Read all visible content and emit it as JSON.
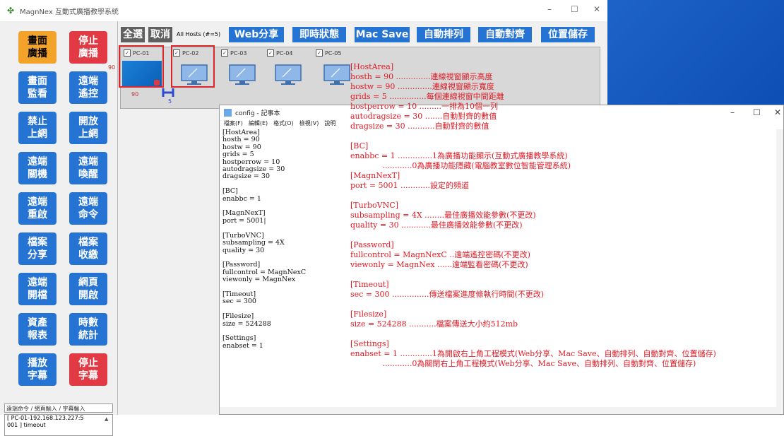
{
  "window": {
    "title": "MagnNex 互動式廣播教學系統",
    "min": "–",
    "max": "☐",
    "close": "✕"
  },
  "sidebar": {
    "buttons": [
      {
        "label": "畫面\n廣播",
        "style": "orange"
      },
      {
        "label": "停止\n廣播",
        "style": "red"
      },
      {
        "label": "畫面\n監看",
        "style": "blue"
      },
      {
        "label": "遠端\n遙控",
        "style": "blue"
      },
      {
        "label": "禁止\n上網",
        "style": "blue"
      },
      {
        "label": "開放\n上網",
        "style": "blue"
      },
      {
        "label": "遠端\n關機",
        "style": "blue"
      },
      {
        "label": "遠端\n喚醒",
        "style": "blue"
      },
      {
        "label": "遠端\n重啟",
        "style": "blue"
      },
      {
        "label": "遠端\n命令",
        "style": "blue"
      },
      {
        "label": "檔案\n分享",
        "style": "blue"
      },
      {
        "label": "檔案\n收繳",
        "style": "blue"
      },
      {
        "label": "遠端\n開檔",
        "style": "blue"
      },
      {
        "label": "網頁\n開啟",
        "style": "blue"
      },
      {
        "label": "資產\n報表",
        "style": "blue"
      },
      {
        "label": "時數\n統計",
        "style": "blue"
      },
      {
        "label": "播放\n字幕",
        "style": "blue"
      },
      {
        "label": "停止\n字幕",
        "style": "red"
      }
    ],
    "command_label": "遠端命令 / 網頁輸入 / 字幕輸入",
    "log": [
      "[ PC-01-192.168.123.227:5",
      "001 ] timeout"
    ]
  },
  "toolbar": {
    "select_all": "全選",
    "cancel": "取消",
    "all_hosts": "All Hosts (#=5)",
    "web_share": "Web分享",
    "instant_status": "即時狀態",
    "mac_save": "Mac Save",
    "auto_arrange": "自動排列",
    "auto_align": "自動對齊",
    "save_position": "位置儲存"
  },
  "hosts": [
    "PC-01",
    "PC-02",
    "PC-03",
    "PC-04",
    "PC-05"
  ],
  "dims": {
    "height": "90",
    "width": "90",
    "grid": "5"
  },
  "notepad": {
    "title": "config - 記事本",
    "menu": [
      "檔案(F)",
      "編輯(E)",
      "格式(O)",
      "檢視(V)",
      "說明"
    ],
    "content": "[HostArea]\nhosth = 90\nhostw = 90\ngrids = 5\nhostperrow = 10\nautodragsize = 30\ndragsize = 30\n\n[BC]\nenabbc = 1\n\n[MagnNexT]\nport = 5001|\n\n[TurboVNC]\nsubsampling = 4X\nquality = 30\n\n[Password]\nfullcontrol = MagnNexC\nviewonly = MagnNex\n\n[Timeout]\nsec = 300\n\n[Filesize]\nsize = 524288\n\n[Settings]\nenabset = 1"
  },
  "annotations": [
    "[HostArea]",
    "hosth = 90 ..............連線視窗顯示高度",
    "hostw = 90 ..............連線視窗顯示寬度",
    "grids = 5 ...............每個連線視窗中間距離",
    "hostperrow = 10 .........一排為10個一列",
    "autodragsize = 30 .......自動對齊的數值",
    "dragsize = 30 ...........自動對齊的數值",
    "",
    "[BC]",
    "enabbc = 1 ..............1為廣播功能顯示(互動式廣播教學系統)",
    "             ............0為廣播功能隱藏(電腦教室數位智能管理系統)",
    "[MagnNexT]",
    "port = 5001 ............設定的頻道",
    "",
    "[TurboVNC]",
    "subsampling = 4X ........最佳廣播效能參數(不更改)",
    "quality = 30 ............最佳廣播效能參數(不更改)",
    "",
    "[Password]",
    "fullcontrol = MagnNexC ..遠端遙控密碼(不更改)",
    "viewonly = MagnNex ......遠端監看密碼(不更改)",
    "",
    "[Timeout]",
    "sec = 300 ...............傳送檔案進度條執行時間(不更改)",
    "",
    "[Filesize]",
    "size = 524288 ...........檔案傳送大小約512mb",
    "",
    "[Settings]",
    "enabset = 1 .............1為開啟右上角工程模式(Web分享、Mac Save、自動排列、自動對齊、位置儲存)",
    "             ............0為關閉右上角工程模式(Web分享、Mac Save、自動排列、自動對齊、位置儲存)"
  ],
  "colors": {
    "blue": "#2574d4",
    "red": "#e23a45",
    "orange": "#f4a32a",
    "annotation": "#e01a24"
  }
}
